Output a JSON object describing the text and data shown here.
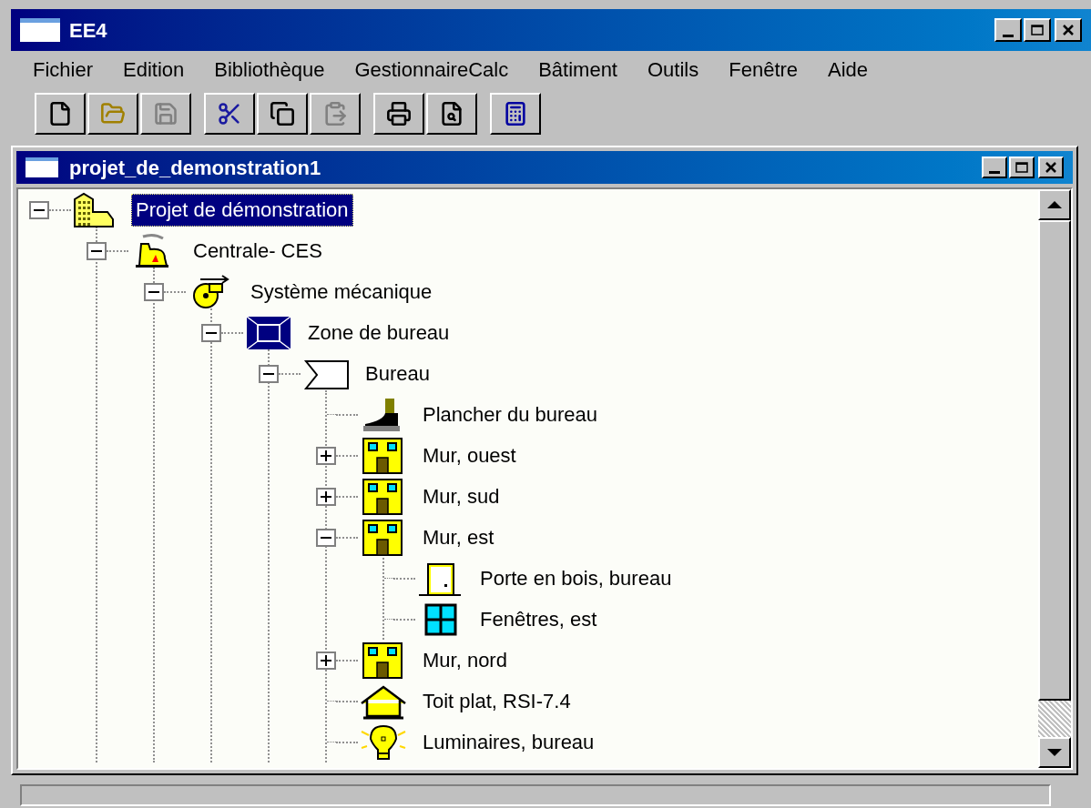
{
  "window": {
    "title": "EE4"
  },
  "menu": [
    "Fichier",
    "Edition",
    "Bibliothèque",
    "GestionnaireCalc",
    "Bâtiment",
    "Outils",
    "Fenêtre",
    "Aide"
  ],
  "toolbar": [
    [
      {
        "kind": "new",
        "disabled": false
      },
      {
        "kind": "open",
        "disabled": false
      },
      {
        "kind": "save",
        "disabled": true
      }
    ],
    [
      {
        "kind": "cut",
        "disabled": false
      },
      {
        "kind": "copy",
        "disabled": false
      },
      {
        "kind": "paste",
        "disabled": true
      }
    ],
    [
      {
        "kind": "print",
        "disabled": false
      },
      {
        "kind": "preview",
        "disabled": false
      }
    ],
    [
      {
        "kind": "calculator",
        "disabled": false
      }
    ]
  ],
  "child_window": {
    "title": "projet_de_demonstration1"
  },
  "tree": [
    {
      "label": "Projet de démonstration",
      "kind": "building",
      "selected": true,
      "expanded": true,
      "children": [
        {
          "label": "Centrale- CES",
          "kind": "plant",
          "selected": false,
          "expanded": true,
          "children": [
            {
              "label": "Système mécanique",
              "kind": "fan",
              "selected": false,
              "expanded": true,
              "children": [
                {
                  "label": "Zone de bureau",
                  "kind": "zone",
                  "selected": false,
                  "expanded": true,
                  "children": [
                    {
                      "label": "Bureau",
                      "kind": "space",
                      "selected": false,
                      "expanded": true,
                      "children": [
                        {
                          "label": "Plancher du bureau",
                          "kind": "floor",
                          "selected": false
                        },
                        {
                          "label": "Mur, ouest",
                          "kind": "wall",
                          "selected": false,
                          "expanded": false
                        },
                        {
                          "label": "Mur, sud",
                          "kind": "wall",
                          "selected": false,
                          "expanded": false
                        },
                        {
                          "label": "Mur, est",
                          "kind": "wall",
                          "selected": false,
                          "expanded": true,
                          "children": [
                            {
                              "label": "Porte en bois, bureau",
                              "kind": "door",
                              "selected": false
                            },
                            {
                              "label": "Fenêtres, est",
                              "kind": "window",
                              "selected": false
                            }
                          ]
                        },
                        {
                          "label": "Mur, nord",
                          "kind": "wall",
                          "selected": false,
                          "expanded": false
                        },
                        {
                          "label": "Toit plat, RSI-7.4",
                          "kind": "roof",
                          "selected": false
                        },
                        {
                          "label": "Luminaires, bureau",
                          "kind": "light",
                          "selected": false
                        }
                      ]
                    }
                  ]
                }
              ]
            }
          ]
        }
      ]
    }
  ]
}
